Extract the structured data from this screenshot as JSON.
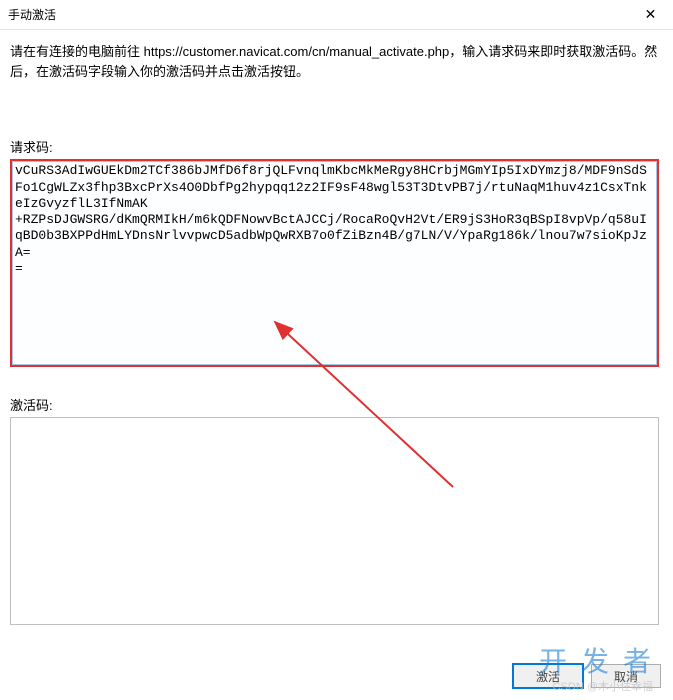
{
  "window": {
    "title": "手动激活"
  },
  "instructions": "请在有连接的电脑前往 https://customer.navicat.com/cn/manual_activate.php，输入请求码来即时获取激活码。然后，在激活码字段输入你的激活码并点击激活按钮。",
  "request": {
    "label": "请求码:",
    "value": "vCuRS3AdIwGUEkDm2TCf386bJMfD6f8rjQLFvnqlmKbcMkMeRgy8HCrbjMGmYIp5IxDYmzj8/MDF9nSdSFo1CgWLZx3fhp3BxcPrXs4O0DbfPg2hypqq12z2IF9sF48wgl53T3DtvPB7j/rtuNaqM1huv4z1CsxTnkeIzGvyzflL3IfNmAK\n+RZPsDJGWSRG/dKmQRMIkH/m6kQDFNowvBctAJCCj/RocaRoQvH2Vt/ER9jS3HoR3qBSpI8vpVp/q58uIqBD0b3BXPPdHmLYDnsNrlvvpwcD5adbWpQwRXB7o0fZiBzn4B/g7LN/V/YpaRg186k/lnou7w7sioKpJzA=\n="
  },
  "activation": {
    "label": "激活码:",
    "value": ""
  },
  "buttons": {
    "activate": "激活",
    "cancel": "取消"
  },
  "watermark": {
    "brand": "开发者",
    "sub": "CSDN @木小住幸福"
  }
}
